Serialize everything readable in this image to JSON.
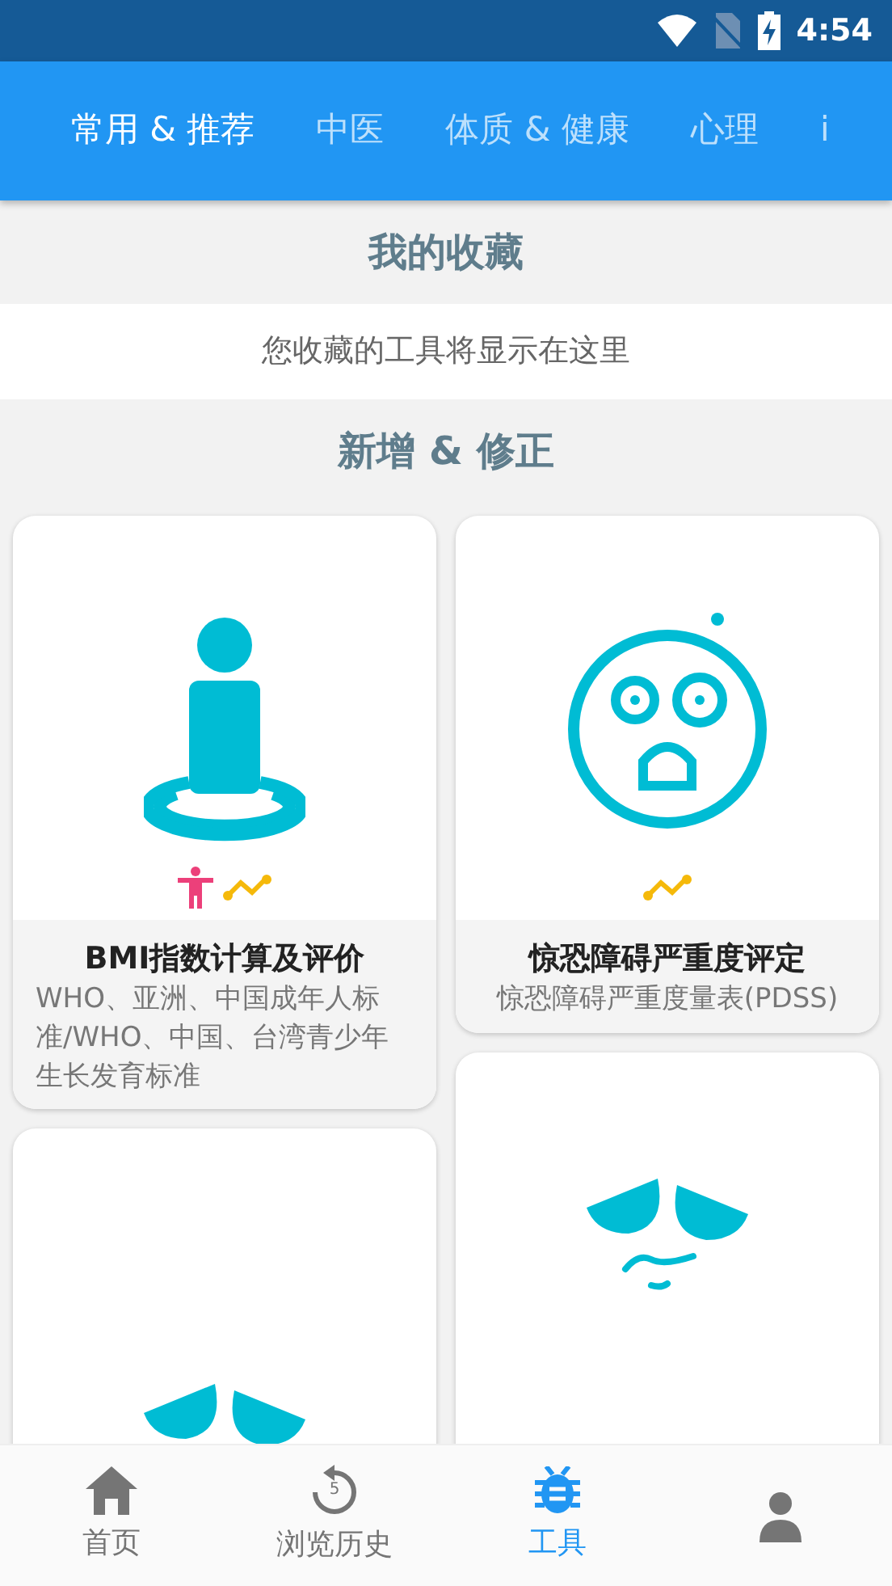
{
  "status_bar": {
    "time": "4:54"
  },
  "tabs": [
    {
      "label": "常用 & 推荐",
      "selected": true
    },
    {
      "label": "中医",
      "selected": false
    },
    {
      "label": "体质 & 健康",
      "selected": false
    },
    {
      "label": "心理",
      "selected": false
    },
    {
      "label": "i",
      "selected": false
    }
  ],
  "favorites": {
    "title": "我的收藏",
    "empty_text": "您收藏的工具将显示在这里"
  },
  "updates": {
    "title": "新增 & 修正",
    "columns": [
      [
        {
          "kind": "person-ring",
          "tags": [
            {
              "kind": "body",
              "color": "#ec407a"
            },
            {
              "kind": "trend",
              "color": "#f5b90a"
            }
          ],
          "title": "BMI指数计算及评价",
          "subtitle": "WHO、亚洲、中国成年人标准/WHO、中国、台湾青少年生长发育标准"
        },
        {
          "kind": "sad-face-low"
        }
      ],
      [
        {
          "kind": "scared-face",
          "tags": [
            {
              "kind": "trend",
              "color": "#f5b90a"
            }
          ],
          "title": "惊恐障碍严重度评定",
          "subtitle": "惊恐障碍严重度量表(PDSS)"
        },
        {
          "kind": "sad-face"
        }
      ]
    ]
  },
  "bottom_nav": [
    {
      "kind": "home",
      "label": "首页",
      "selected": false
    },
    {
      "kind": "history",
      "badge": "5",
      "label": "浏览历史",
      "selected": false
    },
    {
      "kind": "bug",
      "label": "工具",
      "selected": true
    },
    {
      "kind": "person",
      "selected": false
    }
  ]
}
